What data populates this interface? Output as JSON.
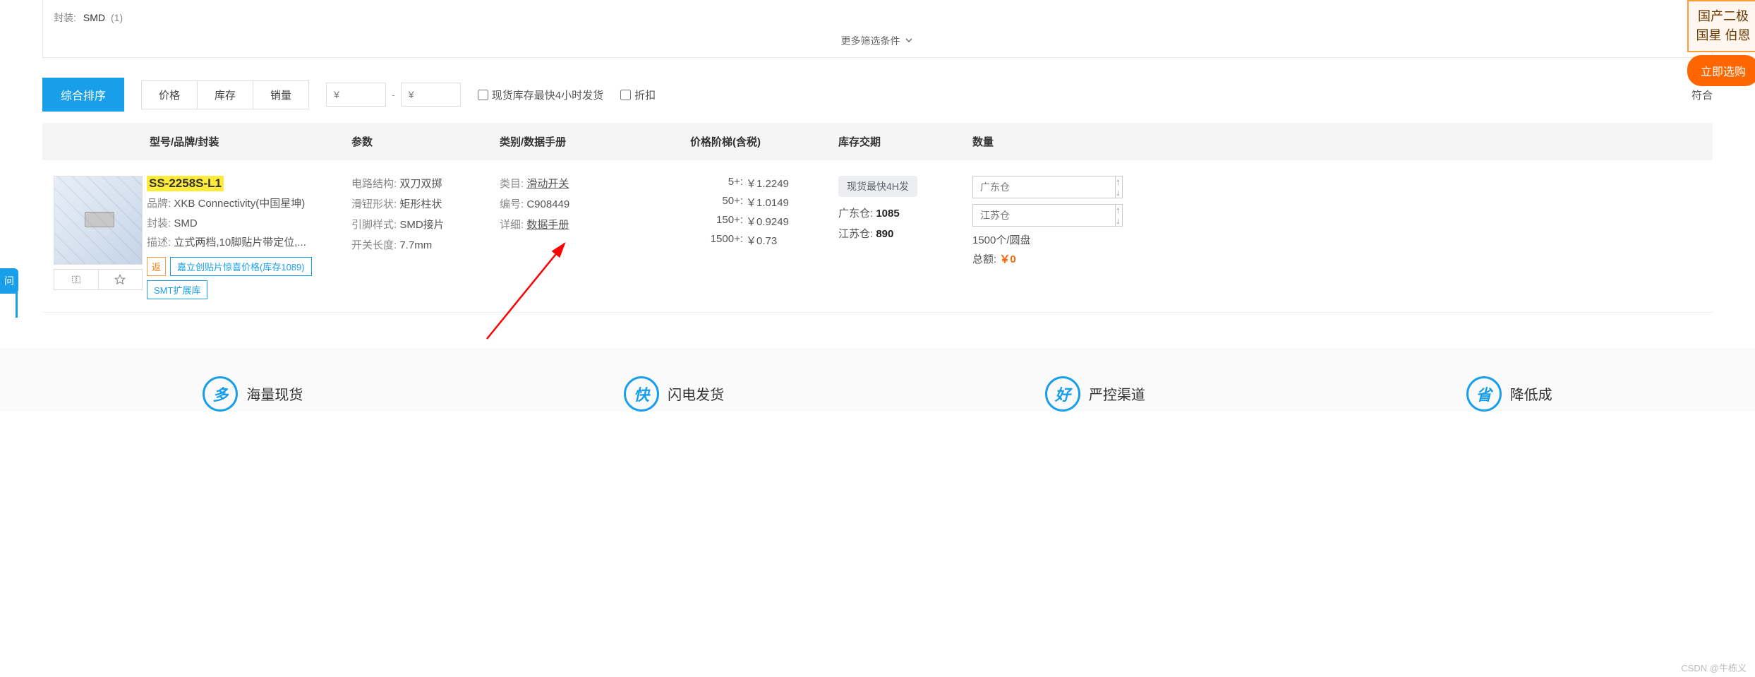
{
  "filter": {
    "package_label": "封装:",
    "package_value": "SMD",
    "package_count": "(1)",
    "more_label": "更多筛选条件"
  },
  "sort": {
    "main": "综合排序",
    "links": [
      "价格",
      "库存",
      "销量"
    ],
    "price_placeholder": "¥",
    "range_sep": "-",
    "chk_stock_4h": "现货库存最快4小时发货",
    "chk_discount": "折扣",
    "match_text": "符合"
  },
  "headers": {
    "model": "型号/品牌/封装",
    "params": "参数",
    "category": "类别/数据手册",
    "price": "价格阶梯(含税)",
    "stock": "库存交期",
    "qty": "数量"
  },
  "product": {
    "model_name": "SS-2258S-L1",
    "brand_label": "品牌:",
    "brand_value": "XKB Connectivity(中国星坤)",
    "package_label": "封装:",
    "package_value": "SMD",
    "desc_label": "描述:",
    "desc_value": "立式两档,10脚贴片带定位,...",
    "tag_return": "返",
    "tag_promo": "嘉立创贴片惊喜价格(库存1089)",
    "tag_smt": "SMT扩展库",
    "params": [
      {
        "lbl": "电路结构:",
        "val": "双刀双掷"
      },
      {
        "lbl": "滑钮形状:",
        "val": "矩形柱状"
      },
      {
        "lbl": "引脚样式:",
        "val": "SMD接片"
      },
      {
        "lbl": "开关长度:",
        "val": "7.7mm"
      }
    ],
    "cat_type_label": "类目:",
    "cat_type_value": "滑动开关",
    "cat_code_label": "编号:",
    "cat_code_value": "C908449",
    "cat_detail_label": "详细:",
    "cat_detail_value": "数据手册",
    "prices": [
      {
        "q": "5+:",
        "p": "￥1.2249"
      },
      {
        "q": "50+:",
        "p": "￥1.0149"
      },
      {
        "q": "150+:",
        "p": "￥0.9249"
      },
      {
        "q": "1500+:",
        "p": "￥0.73"
      }
    ],
    "badge_4h": "现货最快4H发",
    "stock_gd_label": "广东仓:",
    "stock_gd_value": "1085",
    "stock_js_label": "江苏仓:",
    "stock_js_value": "890",
    "qty_gd_placeholder": "广东仓",
    "qty_js_placeholder": "江苏仓",
    "pack_info": "1500个/圆盘",
    "total_label": "总额:",
    "total_value": "￥0"
  },
  "footer": {
    "feat1_icon": "多",
    "feat1_text": "海量现货",
    "feat2_icon": "快",
    "feat2_text": "闪电发货",
    "feat3_icon": "好",
    "feat3_text": "严控渠道",
    "feat4_icon": "省",
    "feat4_text": "降低成"
  },
  "float": {
    "left_icon": "问",
    "promo_line1": "国产二极",
    "promo_line2": "国星 伯恩",
    "promo_btn": "立即选购"
  },
  "watermark": "CSDN @牛栋义"
}
